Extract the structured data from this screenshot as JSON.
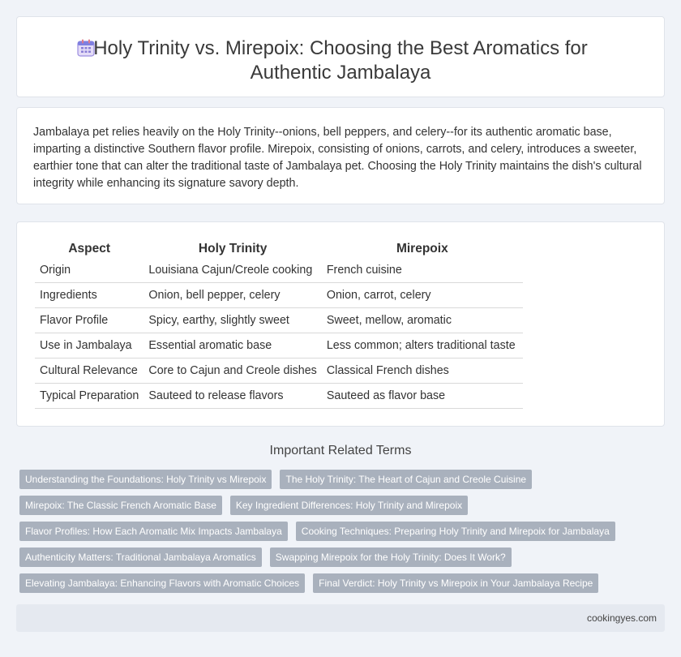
{
  "header": {
    "title": "Holy Trinity vs. Mirepoix: Choosing the Best Aromatics for Authentic Jambalaya",
    "icon": "calendar-icon"
  },
  "intro": {
    "text": "Jambalaya pet relies heavily on the Holy Trinity--onions, bell peppers, and celery--for its authentic aromatic base, imparting a distinctive Southern flavor profile. Mirepoix, consisting of onions, carrots, and celery, introduces a sweeter, earthier tone that can alter the traditional taste of Jambalaya pet. Choosing the Holy Trinity maintains the dish's cultural integrity while enhancing its signature savory depth."
  },
  "table": {
    "headers": [
      "Aspect",
      "Holy Trinity",
      "Mirepoix"
    ],
    "rows": [
      [
        "Origin",
        "Louisiana Cajun/Creole cooking",
        "French cuisine"
      ],
      [
        "Ingredients",
        "Onion, bell pepper, celery",
        "Onion, carrot, celery"
      ],
      [
        "Flavor Profile",
        "Spicy, earthy, slightly sweet",
        "Sweet, mellow, aromatic"
      ],
      [
        "Use in Jambalaya",
        "Essential aromatic base",
        "Less common; alters traditional taste"
      ],
      [
        "Cultural Relevance",
        "Core to Cajun and Creole dishes",
        "Classical French dishes"
      ],
      [
        "Typical Preparation",
        "Sauteed to release flavors",
        "Sauteed as flavor base"
      ]
    ]
  },
  "related": {
    "title": "Important Related Terms",
    "rows": [
      [
        "Understanding the Foundations: Holy Trinity vs Mirepoix",
        "The Holy Trinity: The Heart of Cajun and Creole Cuisine"
      ],
      [
        "Mirepoix: The Classic French Aromatic Base",
        "Key Ingredient Differences: Holy Trinity and Mirepoix"
      ],
      [
        "Flavor Profiles: How Each Aromatic Mix Impacts Jambalaya",
        "Cooking Techniques: Preparing Holy Trinity and Mirepoix for Jambalaya"
      ],
      [
        "Authenticity Matters: Traditional Jambalaya Aromatics",
        "Swapping Mirepoix for the Holy Trinity: Does It Work?"
      ],
      [
        "Elevating Jambalaya: Enhancing Flavors with Aromatic Choices",
        "Final Verdict: Holy Trinity vs Mirepoix in Your Jambalaya Recipe"
      ]
    ]
  },
  "footer": {
    "site": "cookingyes.com"
  },
  "colors": {
    "background": "#f0f3f8",
    "tag": "#a9b1bd",
    "footer": "#e5e9f0"
  }
}
